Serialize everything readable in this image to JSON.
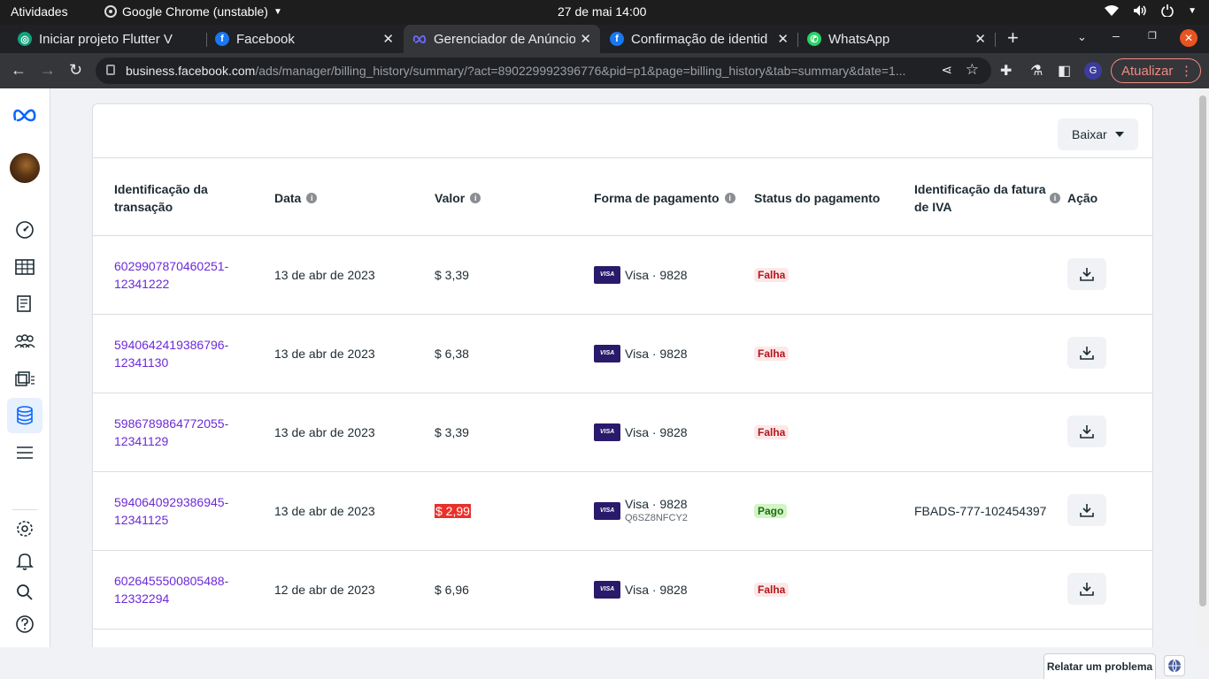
{
  "os_bar": {
    "activities": "Atividades",
    "app_name": "Google Chrome (unstable)",
    "clock": "27 de mai  14:00"
  },
  "tabs": [
    {
      "title": "Iniciar projeto Flutter V",
      "icon": "chatgpt-icon",
      "active": false
    },
    {
      "title": "Facebook",
      "icon": "facebook-icon",
      "active": false
    },
    {
      "title": "Gerenciador de Anúncio",
      "icon": "meta-icon",
      "active": true
    },
    {
      "title": "Confirmação de identid",
      "icon": "facebook-icon",
      "active": false
    },
    {
      "title": "WhatsApp",
      "icon": "whatsapp-icon",
      "active": false
    }
  ],
  "address_bar": {
    "host": "business.facebook.com",
    "path": "/ads/manager/billing_history/summary/?act=890229992396776&pid=p1&page=billing_history&tab=summary&date=1..."
  },
  "toolbar": {
    "profile_initial": "G",
    "update_label": "Atualizar"
  },
  "page": {
    "download_label": "Baixar",
    "columns": {
      "transaction_id": "Identificação da transação",
      "date": "Data",
      "amount": "Valor",
      "payment_method": "Forma de pagamento",
      "payment_status": "Status do pagamento",
      "vat_invoice_id": "Identificação da fatura de IVA",
      "action": "Ação"
    },
    "rows": [
      {
        "id_line1": "6029907870460251-",
        "id_line2": "12341222",
        "date": "13 de abr de 2023",
        "amount": "$ 3,39",
        "card_brand": "VISA",
        "card": "Visa · 9828",
        "card_sub": "",
        "status": "Falha",
        "vat_id": ""
      },
      {
        "id_line1": "5940642419386796-",
        "id_line2": "12341130",
        "date": "13 de abr de 2023",
        "amount": "$ 6,38",
        "card_brand": "VISA",
        "card": "Visa · 9828",
        "card_sub": "",
        "status": "Falha",
        "vat_id": ""
      },
      {
        "id_line1": "5986789864772055-",
        "id_line2": "12341129",
        "date": "13 de abr de 2023",
        "amount": "$ 3,39",
        "card_brand": "VISA",
        "card": "Visa · 9828",
        "card_sub": "",
        "status": "Falha",
        "vat_id": ""
      },
      {
        "id_line1": "5940640929386945-",
        "id_line2": "12341125",
        "date": "13 de abr de 2023",
        "amount": "$ 2,99",
        "card_brand": "VISA",
        "card": "Visa · 9828",
        "card_sub": "Q6SZ8NFCY2",
        "status": "Pago",
        "vat_id": "FBADS-777-102454397"
      },
      {
        "id_line1": "6026455500805488-",
        "id_line2": "12332294",
        "date": "12 de abr de 2023",
        "amount": "$ 6,96",
        "card_brand": "VISA",
        "card": "Visa · 9828",
        "card_sub": "",
        "status": "Falha",
        "vat_id": ""
      }
    ]
  },
  "footer": {
    "report_label": "Relatar um problema"
  },
  "colors": {
    "link": "#6c2ad8",
    "fail_badge": "#fde8e8",
    "paid_badge": "#d1f5c6",
    "highlight": "#e8312b",
    "meta_blue": "#0866ff"
  }
}
